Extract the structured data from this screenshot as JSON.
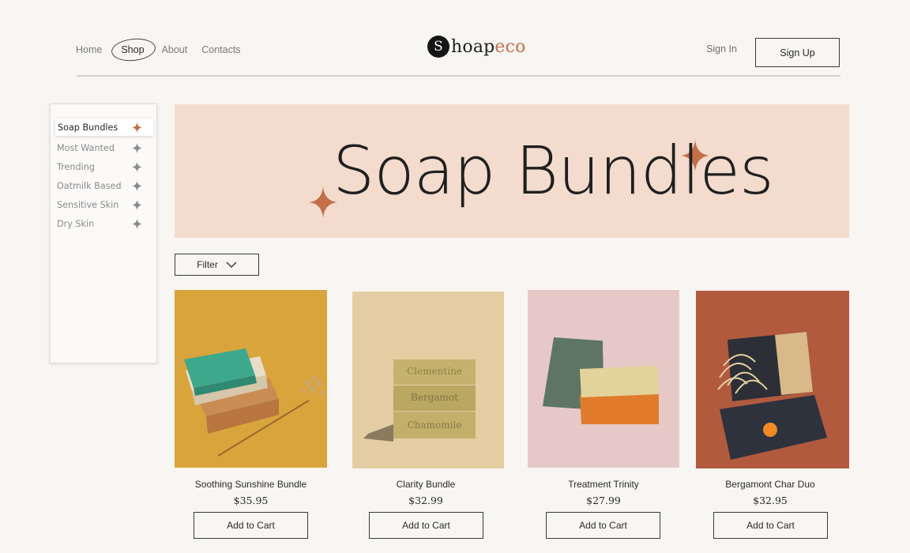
{
  "header": {
    "nav": [
      "Home",
      "Shop",
      "About",
      "Contacts"
    ],
    "logo": {
      "mark": "S",
      "text_a": "hoap",
      "text_b": "eco"
    },
    "sign_in": "Sign In",
    "sign_up": "Sign Up"
  },
  "sidebar": {
    "items": [
      {
        "label": "Soap Bundles",
        "active": true
      },
      {
        "label": "Most Wanted",
        "active": false
      },
      {
        "label": "Trending",
        "active": false
      },
      {
        "label": "Oatmilk Based",
        "active": false
      },
      {
        "label": "Sensitive Skin",
        "active": false
      },
      {
        "label": "Dry Skin",
        "active": false
      }
    ]
  },
  "banner": {
    "title": "Soap Bundles"
  },
  "filter": {
    "label": "Filter"
  },
  "products": [
    {
      "name": "Soothing Sunshine Bundle",
      "price": "$35.95",
      "button": "Add to Cart"
    },
    {
      "name": "Clarity Bundle",
      "price": "$32.99",
      "button": "Add to Cart",
      "stamps": [
        "Clementine",
        "Bergamot",
        "Chamomile"
      ]
    },
    {
      "name": "Treatment Trinity",
      "price": "$27.99",
      "button": "Add to Cart"
    },
    {
      "name": "Bergamont Char Duo",
      "price": "$32.95",
      "button": "Add to Cart"
    }
  ],
  "colors": {
    "accent": "#c26f4a",
    "banner_bg": "#f3dccd",
    "page_bg": "#f8f6f3",
    "product_bgs": [
      "#d9a43c",
      "#e4cda2",
      "#e6c9c7",
      "#b15a3e"
    ]
  }
}
